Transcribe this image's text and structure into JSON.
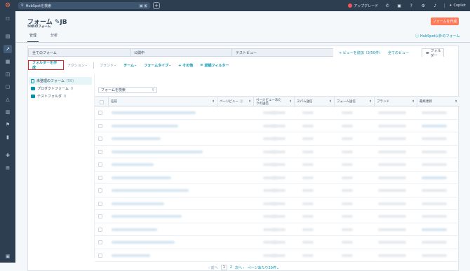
{
  "topbar": {
    "search_placeholder": "HubSpotを検索",
    "kbd": [
      "⌘",
      "K"
    ],
    "upgrade_label": "アップグレード",
    "copilot_label": "Copilot"
  },
  "header": {
    "title": "フォーム",
    "title_suffix": "JB",
    "subtitle": "50件のフォーム",
    "create_button": "フォームを作成",
    "tabs": [
      "管理",
      "分析"
    ],
    "external_link": "HubSpot以外のフォーム"
  },
  "view_tabs": {
    "all_forms": "全てのフォーム",
    "published": "公開中",
    "test_view": "テストビュー",
    "add_view": "+ ビューを追加（3/50件）",
    "all_views": "全てのビュー",
    "folders": "フォルダー"
  },
  "filters": {
    "create_folder": "フォルダーを作成",
    "actions": "アクション",
    "brand": "ブランド",
    "team": "チーム",
    "form_type": "フォームタイプ",
    "other": "+ その他",
    "advanced": "詳細フィルター"
  },
  "folder_tree": [
    {
      "label": "未整理のフォーム",
      "count": "(50)"
    },
    {
      "label": "プロダクトフォーム",
      "count": "0"
    },
    {
      "label": "テストフォルダ",
      "count": "0"
    }
  ],
  "table": {
    "search_placeholder": "フォームを検索",
    "columns": [
      "名前",
      "ページビュー",
      "ページビューあたりの送信",
      "スパム送信",
      "フォーム送信",
      "ブランド",
      "最終更新"
    ]
  },
  "pagination": {
    "prev": "前へ",
    "current": "1",
    "next_page": "2",
    "next": "次へ",
    "per_page": "ページあたり20件"
  },
  "colors": {
    "accent": "#ff7a59",
    "link": "#0091ae",
    "nav_bg": "#2d3e50",
    "highlight": "#e02020"
  }
}
